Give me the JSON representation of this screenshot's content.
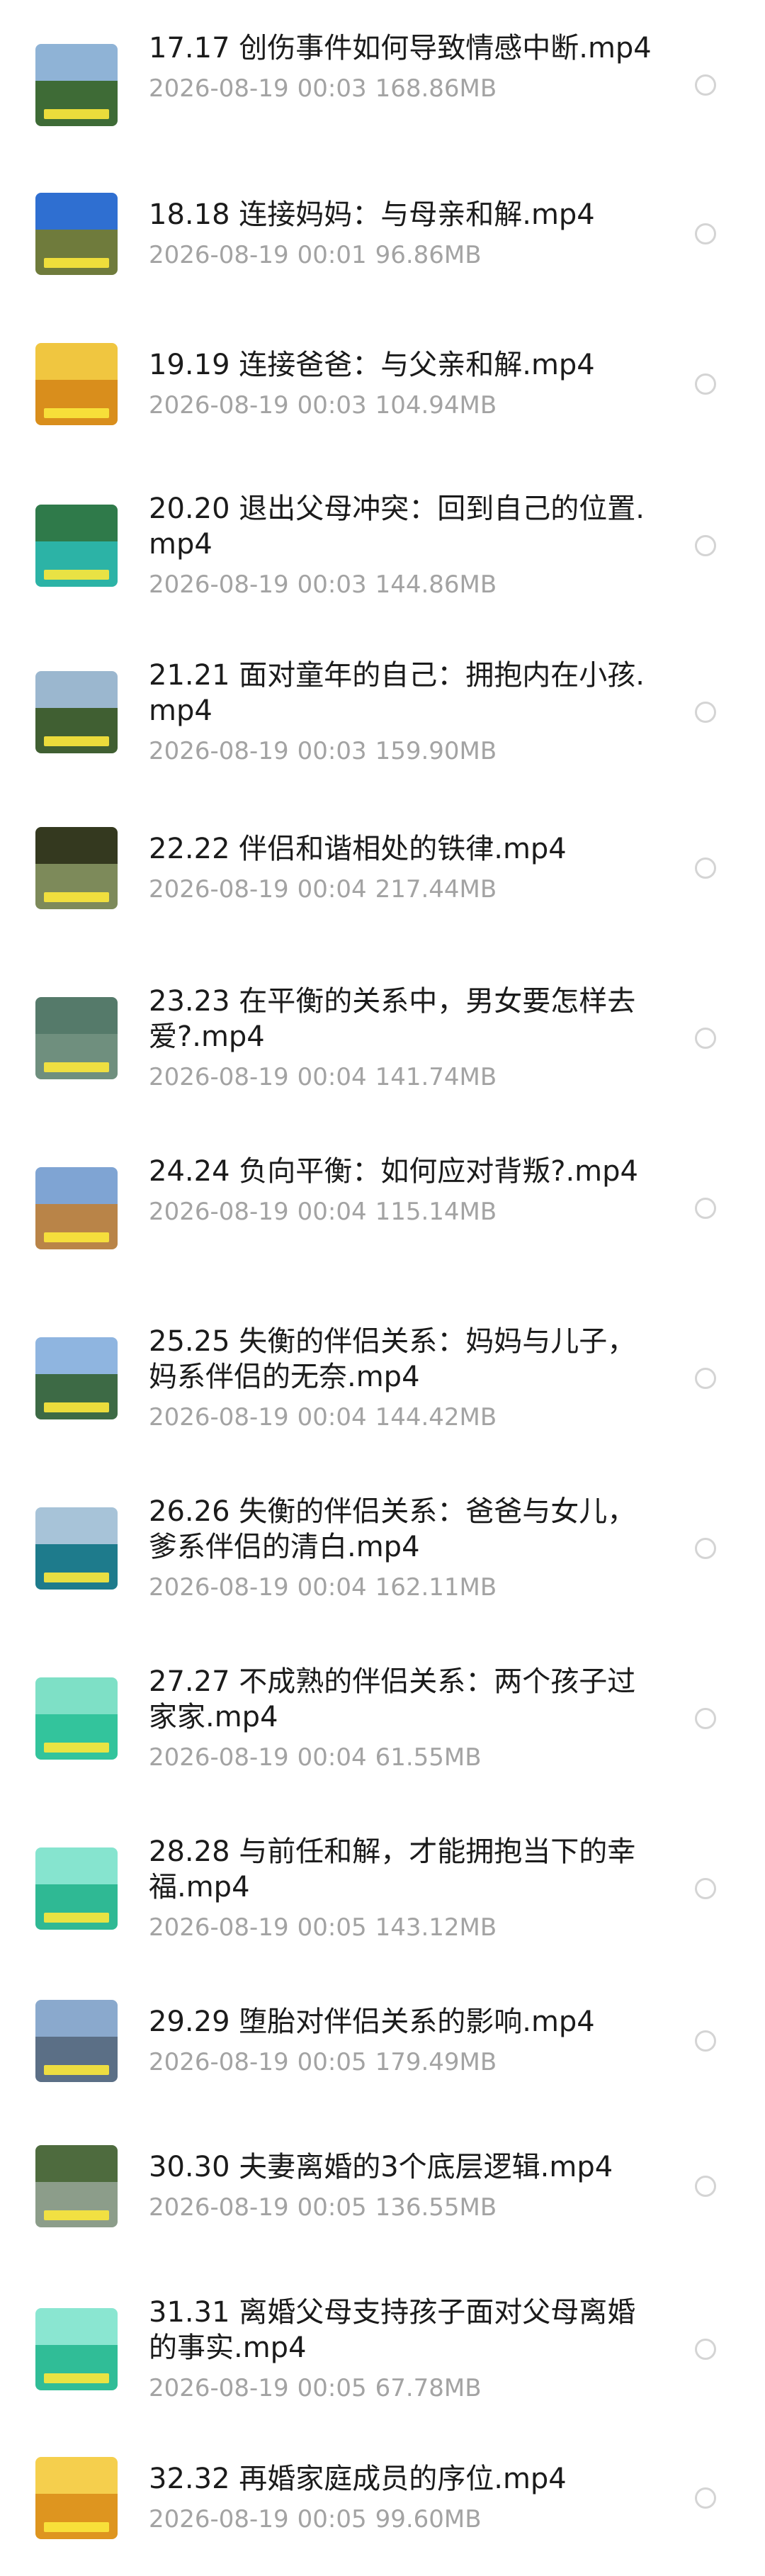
{
  "files": [
    {
      "name": "17.17 创伤事件如何导致情感中断.mp4",
      "date": "2026-08-19",
      "time": "00:03",
      "size": "168.86MB",
      "thumb": {
        "sky": "#8fb3d6",
        "land": "#3e6b36"
      }
    },
    {
      "name": "18.18 连接妈妈：与母亲和解.mp4",
      "date": "2026-08-19",
      "time": "00:01",
      "size": "96.86MB",
      "thumb": {
        "sky": "#2f6fd1",
        "land": "#6f7b3c"
      }
    },
    {
      "name": "19.19 连接爸爸：与父亲和解.mp4",
      "date": "2026-08-19",
      "time": "00:03",
      "size": "104.94MB",
      "thumb": {
        "sky": "#f0c640",
        "land": "#d98e1c"
      }
    },
    {
      "name": "20.20 退出父母冲突：回到自己的位置.mp4",
      "date": "2026-08-19",
      "time": "00:03",
      "size": "144.86MB",
      "thumb": {
        "sky": "#2f7a4a",
        "land": "#2cb3a6"
      }
    },
    {
      "name": "21.21 面对童年的自己：拥抱内在小孩.mp4",
      "date": "2026-08-19",
      "time": "00:03",
      "size": "159.90MB",
      "thumb": {
        "sky": "#9bb7cf",
        "land": "#405f32"
      }
    },
    {
      "name": "22.22 伴侣和谐相处的铁律.mp4",
      "date": "2026-08-19",
      "time": "00:04",
      "size": "217.44MB",
      "thumb": {
        "sky": "#34391f",
        "land": "#7d8a5a"
      }
    },
    {
      "name": "23.23 在平衡的关系中，男女要怎样去爱?.mp4",
      "date": "2026-08-19",
      "time": "00:04",
      "size": "141.74MB",
      "thumb": {
        "sky": "#557a6a",
        "land": "#6f8f7e"
      }
    },
    {
      "name": "24.24 负向平衡：如何应对背叛?.mp4",
      "date": "2026-08-19",
      "time": "00:04",
      "size": "115.14MB",
      "thumb": {
        "sky": "#7fa4d3",
        "land": "#b98448"
      }
    },
    {
      "name": "25.25 失衡的伴侣关系：妈妈与儿子，妈系伴侣的无奈.mp4",
      "date": "2026-08-19",
      "time": "00:04",
      "size": "144.42MB",
      "thumb": {
        "sky": "#8fb5e0",
        "land": "#3d6a45"
      }
    },
    {
      "name": "26.26 失衡的伴侣关系：爸爸与女儿，爹系伴侣的清白.mp4",
      "date": "2026-08-19",
      "time": "00:04",
      "size": "162.11MB",
      "thumb": {
        "sky": "#a7c3d8",
        "land": "#1e7b8c"
      }
    },
    {
      "name": "27.27 不成熟的伴侣关系：两个孩子过家家.mp4",
      "date": "2026-08-19",
      "time": "00:04",
      "size": "61.55MB",
      "thumb": {
        "sky": "#7ee0c6",
        "land": "#33c49c"
      }
    },
    {
      "name": "28.28 与前任和解，才能拥抱当下的幸福.mp4",
      "date": "2026-08-19",
      "time": "00:05",
      "size": "143.12MB",
      "thumb": {
        "sky": "#86e4cf",
        "land": "#2fb994"
      }
    },
    {
      "name": "29.29 堕胎对伴侣关系的影响.mp4",
      "date": "2026-08-19",
      "time": "00:05",
      "size": "179.49MB",
      "thumb": {
        "sky": "#8aa9cd",
        "land": "#5b6f86"
      }
    },
    {
      "name": "30.30 夫妻离婚的3个底层逻辑.mp4",
      "date": "2026-08-19",
      "time": "00:05",
      "size": "136.55MB",
      "thumb": {
        "sky": "#4e6b3e",
        "land": "#8c9d8a"
      }
    },
    {
      "name": "31.31 离婚父母支持孩子面对父母离婚的事实.mp4",
      "date": "2026-08-19",
      "time": "00:05",
      "size": "67.78MB",
      "thumb": {
        "sky": "#8ae6d1",
        "land": "#30bd97"
      }
    },
    {
      "name": "32.32 再婚家庭成员的序位.mp4",
      "date": "2026-08-19",
      "time": "00:05",
      "size": "99.60MB",
      "thumb": {
        "sky": "#f5cf4d",
        "land": "#de951f"
      }
    }
  ]
}
